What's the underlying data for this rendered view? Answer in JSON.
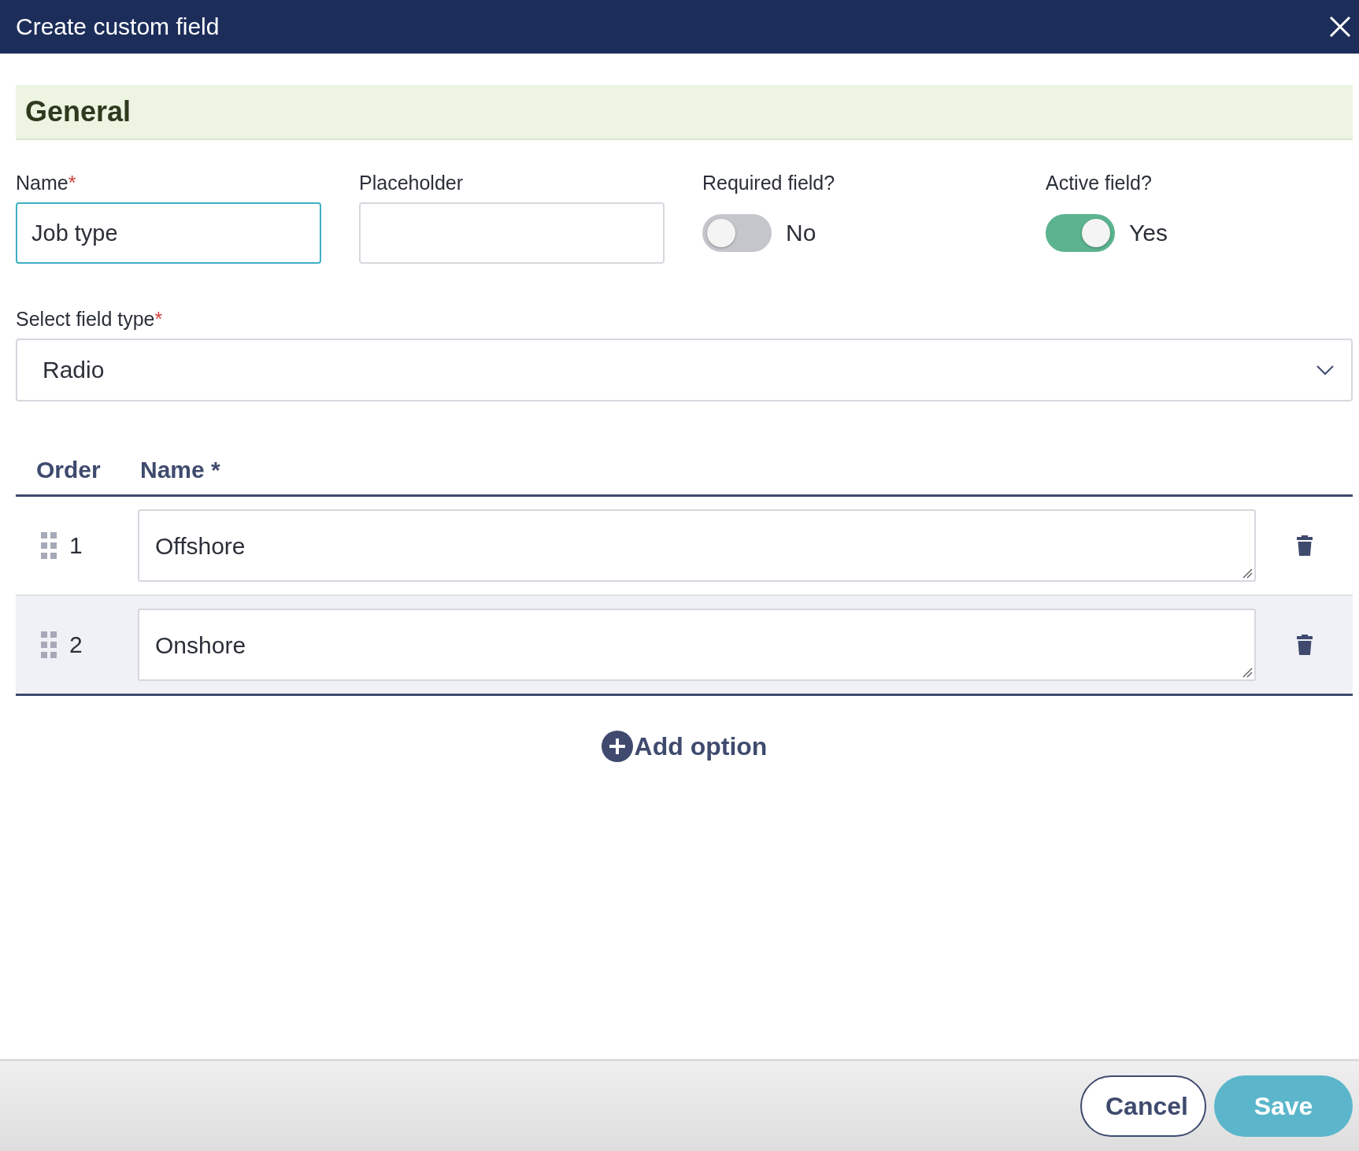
{
  "window": {
    "title": "Create custom field"
  },
  "section": {
    "title": "General"
  },
  "fields": [
    {
      "kind": "text",
      "label": "Name",
      "required_mark": "*",
      "value": "Job type",
      "focused": true
    },
    {
      "kind": "text",
      "label": "Placeholder",
      "focused": false
    },
    {
      "kind": "toggle",
      "label": "Required field?",
      "on": false,
      "state_label": "No"
    },
    {
      "kind": "toggle",
      "label": "Active field?",
      "on": true,
      "state_label": "Yes"
    }
  ],
  "field_type": {
    "label": "Select field type",
    "required_mark": "*",
    "value": "Radio"
  },
  "options": {
    "columns": [
      "Order",
      "Name *"
    ],
    "rows": [
      {
        "order": "1",
        "name": "Offshore",
        "highlighted": false
      },
      {
        "order": "2",
        "name": "Onshore",
        "highlighted": true
      }
    ]
  },
  "add_option": "Add option",
  "buttons": [
    {
      "kind": "secondary",
      "label": "Cancel"
    },
    {
      "kind": "primary",
      "label": "Save"
    }
  ]
}
